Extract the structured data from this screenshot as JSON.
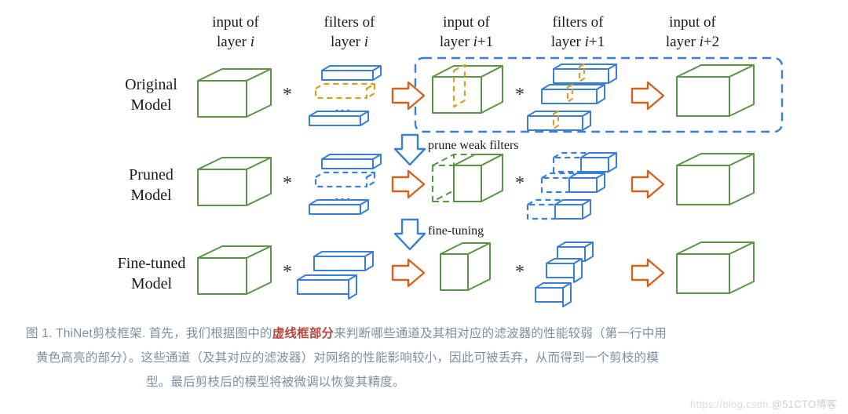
{
  "figure": {
    "column_headers": [
      {
        "line1": "input of",
        "line2_pre": "layer ",
        "line2_it": "i",
        "line2_post": ""
      },
      {
        "line1": "filters of",
        "line2_pre": "layer ",
        "line2_it": "i",
        "line2_post": ""
      },
      {
        "line1": "input of",
        "line2_pre": "layer ",
        "line2_it": "i",
        "line2_post": "+1"
      },
      {
        "line1": "filters of",
        "line2_pre": "layer ",
        "line2_it": "i",
        "line2_post": "+1"
      },
      {
        "line1": "input of",
        "line2_pre": "layer ",
        "line2_it": "i",
        "line2_post": "+2"
      }
    ],
    "row_labels": [
      {
        "line1": "Original",
        "line2": "Model"
      },
      {
        "line1": "Pruned",
        "line2": "Model"
      },
      {
        "line1": "Fine-tuned",
        "line2": "Model"
      }
    ],
    "stage_labels": [
      "prune weak filters",
      "fine-tuning"
    ],
    "operator_symbol": "*",
    "ellipsis_symbol": "...",
    "colors": {
      "cube_green": "#5b9447",
      "filter_blue": "#3b7fd4",
      "highlight_yellow": "#d7a021",
      "arrow_orange": "#d4621f",
      "dashed_box_blue": "#3b7fd4",
      "caption_text": "#7d8fa3",
      "caption_accent": "#b5483f",
      "heading_text": "#1a1a1a"
    }
  },
  "caption": {
    "line1_a": "图 1. ThiNet剪枝框架. 首先，我们根据图中的",
    "line1_strong": "虚线框部分",
    "line1_b": "来判断哪些通道及其相对应的滤波器的性能较弱（第一行中用",
    "line2": "黄色高亮的部分）。这些通道（及其对应的滤波器）对网络的性能影响较小，因此可被丢弃，从而得到一个剪枝的模",
    "line3": "型。最后剪枝后的模型将被微调以恢复其精度。"
  },
  "watermark": {
    "url": "https://blog.csdn.",
    "handle": "@51CTO博客"
  }
}
